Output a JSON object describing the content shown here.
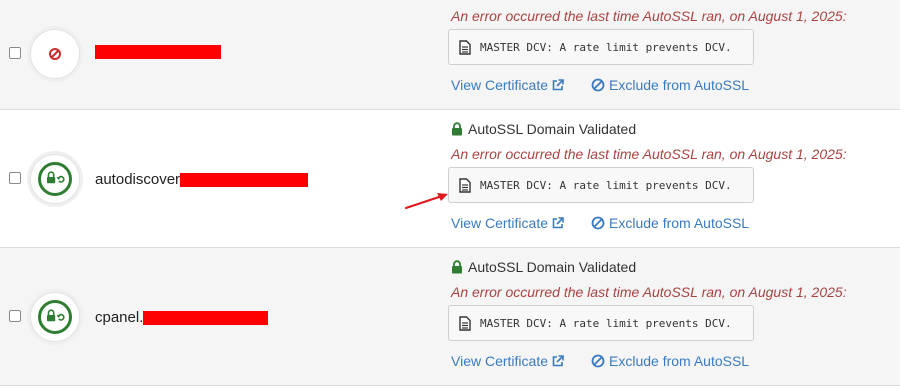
{
  "rows": [
    {
      "domain_prefix": "",
      "error_text": "An error occurred the last time AutoSSL ran, on August 1, 2025:",
      "dcv_message": "MASTER DCV: A rate limit prevents DCV.",
      "view_label": "View Certificate",
      "exclude_label": "Exclude from AutoSSL",
      "status_icon": "blocked-icon"
    },
    {
      "domain_prefix": "autodiscover",
      "validated_label": "AutoSSL Domain Validated",
      "error_text": "An error occurred the last time AutoSSL ran, on August 1, 2025:",
      "dcv_message": "MASTER DCV: A rate limit prevents DCV.",
      "view_label": "View Certificate",
      "exclude_label": "Exclude from AutoSSL",
      "status_icon": "lock-sync-icon"
    },
    {
      "domain_prefix": "cpanel.",
      "validated_label": "AutoSSL Domain Validated",
      "error_text": "An error occurred the last time AutoSSL ran, on August 1, 2025:",
      "dcv_message": "MASTER DCV: A rate limit prevents DCV.",
      "view_label": "View Certificate",
      "exclude_label": "Exclude from AutoSSL",
      "status_icon": "lock-sync-icon"
    }
  ],
  "colors": {
    "error": "#a94442",
    "link": "#3a7bbf",
    "validated_green": "#2e7d32",
    "redaction": "#ff0000",
    "annotation_arrow": "#e0191f"
  }
}
